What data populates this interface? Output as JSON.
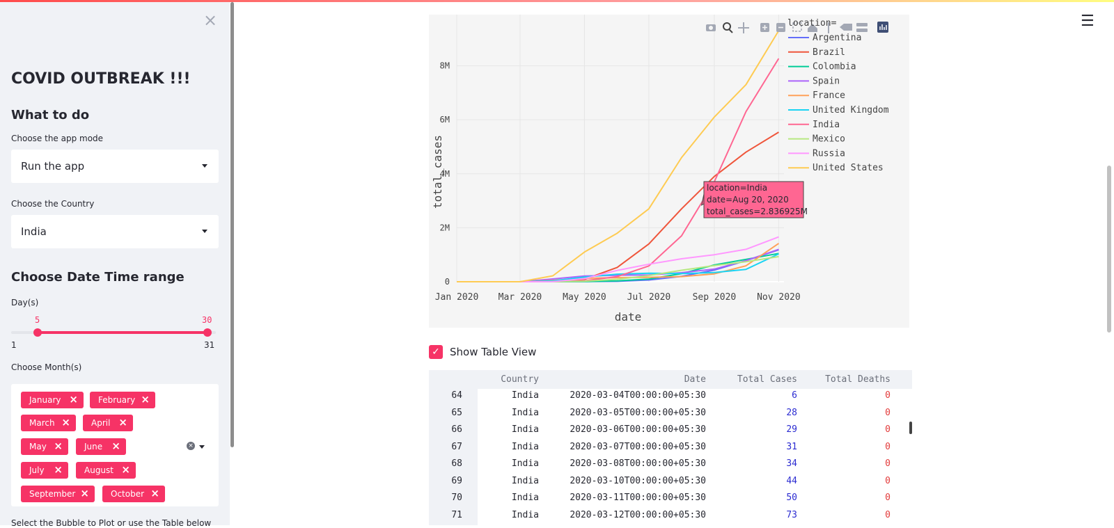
{
  "sidebar": {
    "close_icon": "×",
    "title": "COVID OUTBREAK !!!",
    "what_to_do": "What to do",
    "mode_label": "Choose the app mode",
    "mode_value": "Run the app",
    "country_label": "Choose the Country",
    "country_value": "India",
    "date_heading": "Choose Date Time range",
    "day_label": "Day(s)",
    "day_low": "5",
    "day_high": "30",
    "day_min": "1",
    "day_max": "31",
    "month_label": "Choose Month(s)",
    "months": [
      "January",
      "February",
      "March",
      "April",
      "May",
      "June",
      "July",
      "August",
      "September",
      "October"
    ],
    "cutoff_text": "Select the Bubble to Plot or use the Table below"
  },
  "main": {
    "hamburger_icon": "☰",
    "show_table_label": "Show Table View",
    "checkbox_mark": "✓"
  },
  "chart_data": {
    "type": "line",
    "xlabel": "date",
    "ylabel": "total_cases",
    "x_ticks": [
      "Jan 2020",
      "Mar 2020",
      "May 2020",
      "Jul 2020",
      "Sep 2020",
      "Nov 2020"
    ],
    "y_ticks": [
      "0",
      "2M",
      "4M",
      "6M",
      "8M"
    ],
    "ylim": [
      0,
      9500000
    ],
    "legend_title": "location=",
    "legend_placement": "top-right",
    "x": [
      "2020-01-01",
      "2020-02-01",
      "2020-03-01",
      "2020-04-01",
      "2020-05-01",
      "2020-06-01",
      "2020-07-01",
      "2020-08-01",
      "2020-09-01",
      "2020-10-01",
      "2020-11-01"
    ],
    "series": [
      {
        "name": "Argentina",
        "color": "#636efa",
        "values": [
          0,
          0,
          0,
          1000,
          4000,
          16000,
          64000,
          200000,
          430000,
          780000,
          1180000
        ]
      },
      {
        "name": "Brazil",
        "color": "#ef553b",
        "values": [
          0,
          0,
          0,
          6000,
          90000,
          530000,
          1400000,
          2700000,
          3900000,
          4800000,
          5540000
        ]
      },
      {
        "name": "Colombia",
        "color": "#00cc96",
        "values": [
          0,
          0,
          0,
          1000,
          7000,
          30000,
          100000,
          300000,
          620000,
          830000,
          1050000
        ]
      },
      {
        "name": "Spain",
        "color": "#ab63fa",
        "values": [
          0,
          0,
          100,
          104000,
          215000,
          239000,
          249000,
          335000,
          470000,
          780000,
          1200000
        ]
      },
      {
        "name": "France",
        "color": "#ffa15a",
        "values": [
          0,
          0,
          100,
          52000,
          130000,
          151000,
          165000,
          190000,
          290000,
          590000,
          1420000
        ]
      },
      {
        "name": "United Kingdom",
        "color": "#19d3f3",
        "values": [
          0,
          0,
          30,
          30000,
          175000,
          280000,
          315000,
          305000,
          340000,
          460000,
          1030000
        ]
      },
      {
        "name": "India",
        "color": "#ff6692",
        "values": [
          0,
          0,
          3,
          1600,
          35000,
          190000,
          585000,
          1700000,
          3700000,
          6300000,
          8270000
        ]
      },
      {
        "name": "Mexico",
        "color": "#b6e880",
        "values": [
          0,
          0,
          5,
          1200,
          20000,
          90000,
          230000,
          425000,
          600000,
          740000,
          930000
        ]
      },
      {
        "name": "Russia",
        "color": "#ff97ff",
        "values": [
          0,
          0,
          3,
          3000,
          115000,
          420000,
          650000,
          850000,
          1000000,
          1200000,
          1660000
        ]
      },
      {
        "name": "United States",
        "color": "#fecb52",
        "values": [
          0,
          10,
          70,
          220000,
          1100000,
          1800000,
          2700000,
          4600000,
          6100000,
          7300000,
          9300000
        ]
      }
    ],
    "tooltip": {
      "location": "location=India",
      "date": "date=Aug 20, 2020",
      "total": "total_cases=2.836925M",
      "x": "2020-08-20",
      "y": 2836925
    }
  },
  "table": {
    "headers": [
      "Country",
      "Date",
      "Total Cases",
      "Total Deaths"
    ],
    "rows": [
      {
        "idx": "64",
        "country": "India",
        "date": "2020-03-04T00:00:00+05:30",
        "cases": "6",
        "deaths": "0"
      },
      {
        "idx": "65",
        "country": "India",
        "date": "2020-03-05T00:00:00+05:30",
        "cases": "28",
        "deaths": "0"
      },
      {
        "idx": "66",
        "country": "India",
        "date": "2020-03-06T00:00:00+05:30",
        "cases": "29",
        "deaths": "0"
      },
      {
        "idx": "67",
        "country": "India",
        "date": "2020-03-07T00:00:00+05:30",
        "cases": "31",
        "deaths": "0"
      },
      {
        "idx": "68",
        "country": "India",
        "date": "2020-03-08T00:00:00+05:30",
        "cases": "34",
        "deaths": "0"
      },
      {
        "idx": "69",
        "country": "India",
        "date": "2020-03-10T00:00:00+05:30",
        "cases": "44",
        "deaths": "0"
      },
      {
        "idx": "70",
        "country": "India",
        "date": "2020-03-11T00:00:00+05:30",
        "cases": "50",
        "deaths": "0"
      },
      {
        "idx": "71",
        "country": "India",
        "date": "2020-03-12T00:00:00+05:30",
        "cases": "73",
        "deaths": "0"
      }
    ]
  },
  "colors": {
    "accent": "#f63366",
    "sidebar_bg": "#f0f2f6",
    "plot_bg": "#f5f5f5"
  }
}
